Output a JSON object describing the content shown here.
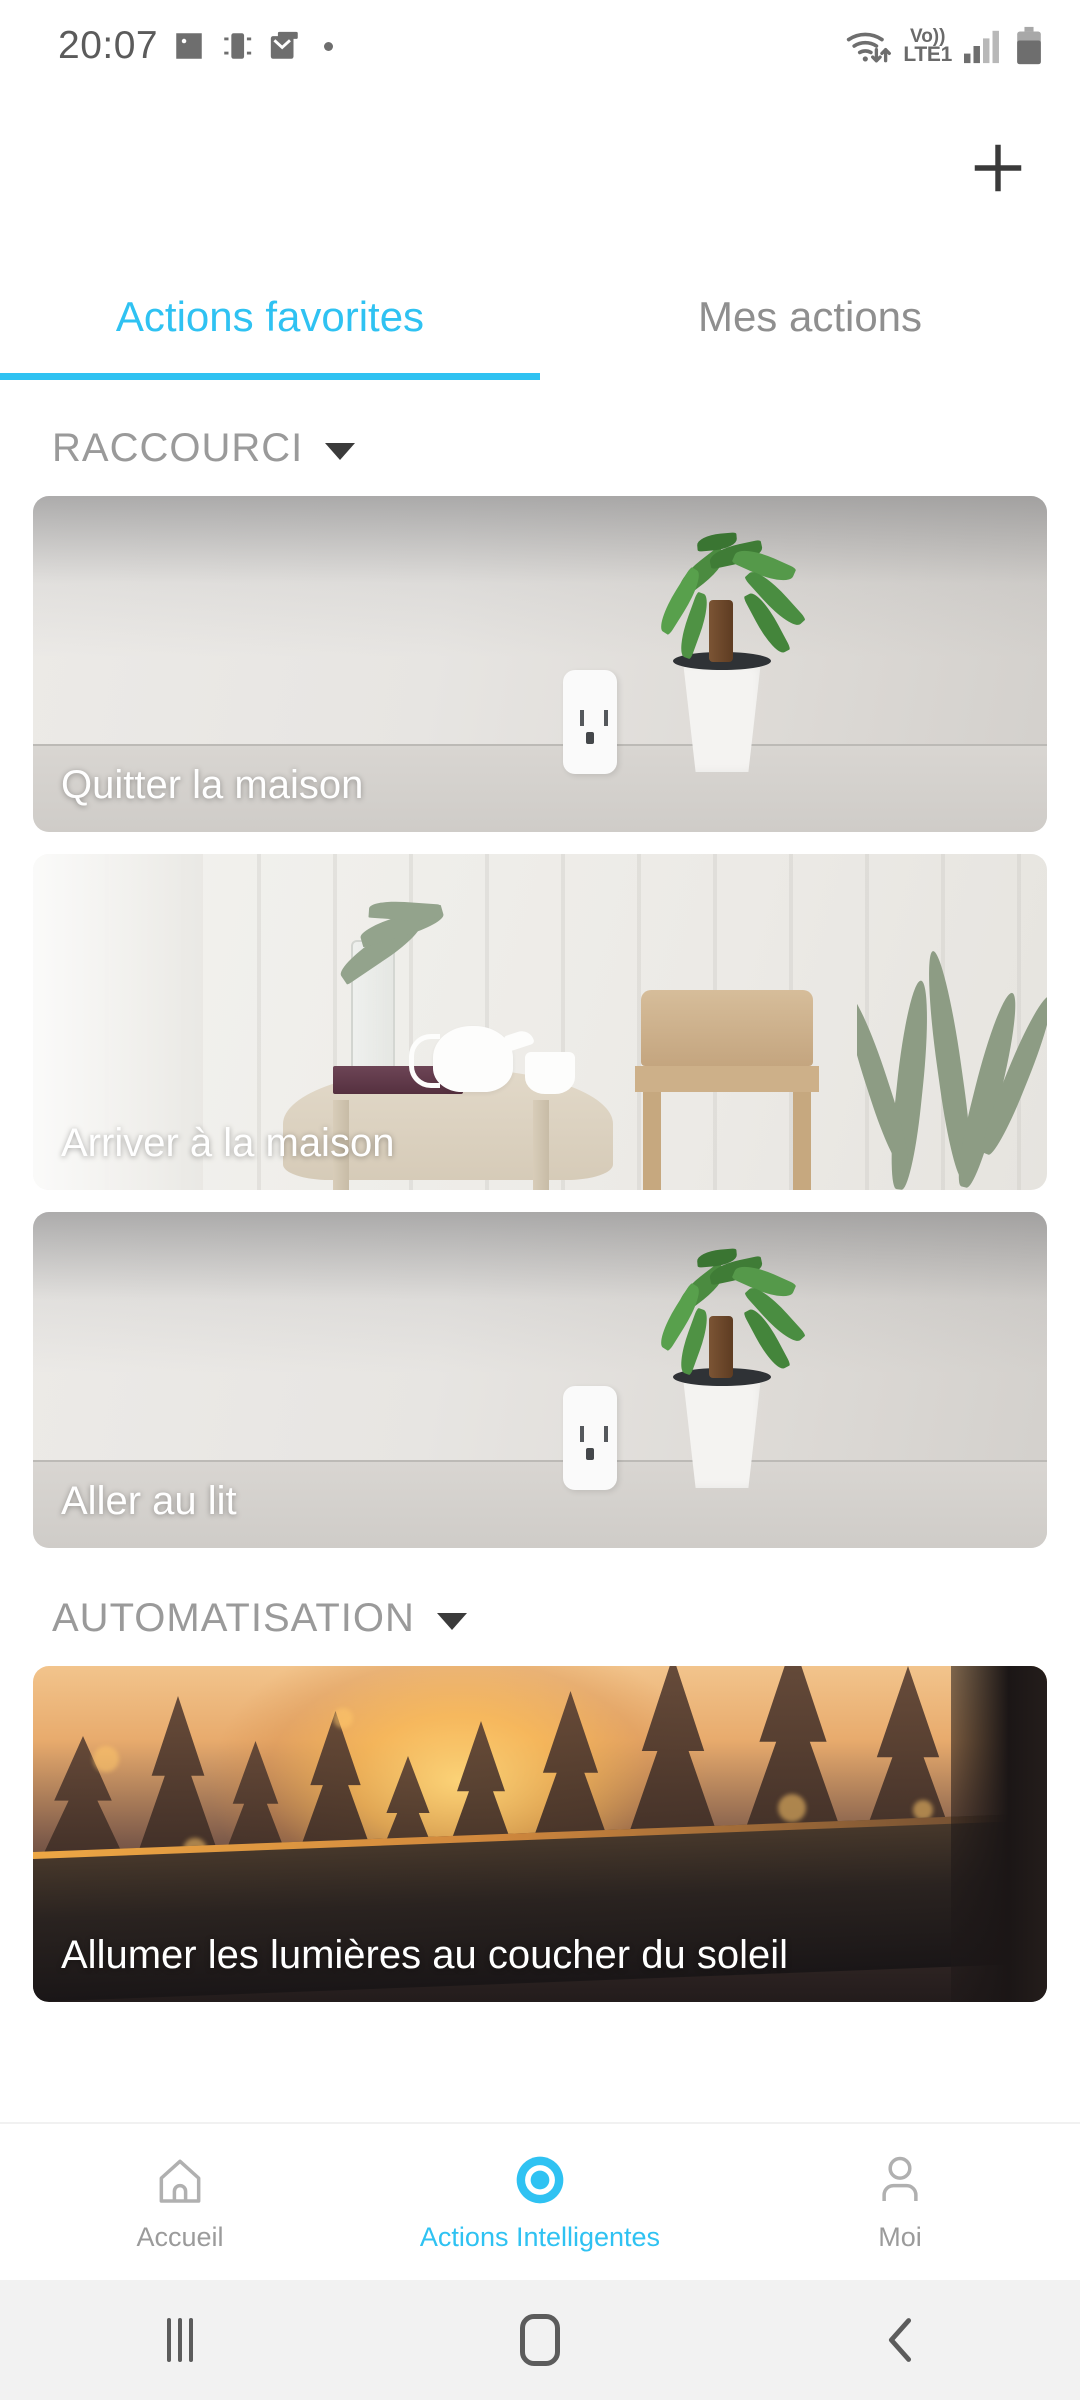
{
  "status_bar": {
    "time": "20:07",
    "left_icons": [
      "image-icon",
      "screen-mirror-icon",
      "mail-icon",
      "more-dot-icon"
    ],
    "network_label_top": "Vo))",
    "network_label_bottom": "LTE1",
    "right_icons": [
      "wifi-transfer-icon",
      "signal-bars-icon",
      "battery-icon"
    ]
  },
  "header": {
    "add_label": "+"
  },
  "tabs": [
    {
      "label": "Actions favorites",
      "active": true
    },
    {
      "label": "Mes actions",
      "active": false
    }
  ],
  "sections": [
    {
      "title": "RACCOURCI",
      "expanded": true,
      "cards": [
        {
          "label": "Quitter la maison",
          "scene": "plant-room"
        },
        {
          "label": "Arriver à la maison",
          "scene": "bright-interior"
        },
        {
          "label": "Aller au lit",
          "scene": "plant-room"
        }
      ]
    },
    {
      "title": "AUTOMATISATION",
      "expanded": true,
      "cards": [
        {
          "label": "Allumer les lumières au coucher du soleil",
          "scene": "sunset-window"
        }
      ]
    }
  ],
  "bottom_nav": [
    {
      "label": "Accueil",
      "icon": "home-icon",
      "active": false
    },
    {
      "label": "Actions Intelligentes",
      "icon": "smart-actions-ring-icon",
      "active": true
    },
    {
      "label": "Moi",
      "icon": "person-icon",
      "active": false
    }
  ],
  "system_nav": [
    {
      "name": "recents-button",
      "icon": "recents-icon"
    },
    {
      "name": "home-button",
      "icon": "home-square-icon"
    },
    {
      "name": "back-button",
      "icon": "back-chevron-icon"
    }
  ],
  "colors": {
    "accent": "#2fc2f2",
    "inactive_text": "#8f8f8f",
    "section_title": "#9a9a9a",
    "card_label": "#ffffff",
    "page_background": "#ffffff",
    "system_nav_background": "#f2f2f2"
  }
}
